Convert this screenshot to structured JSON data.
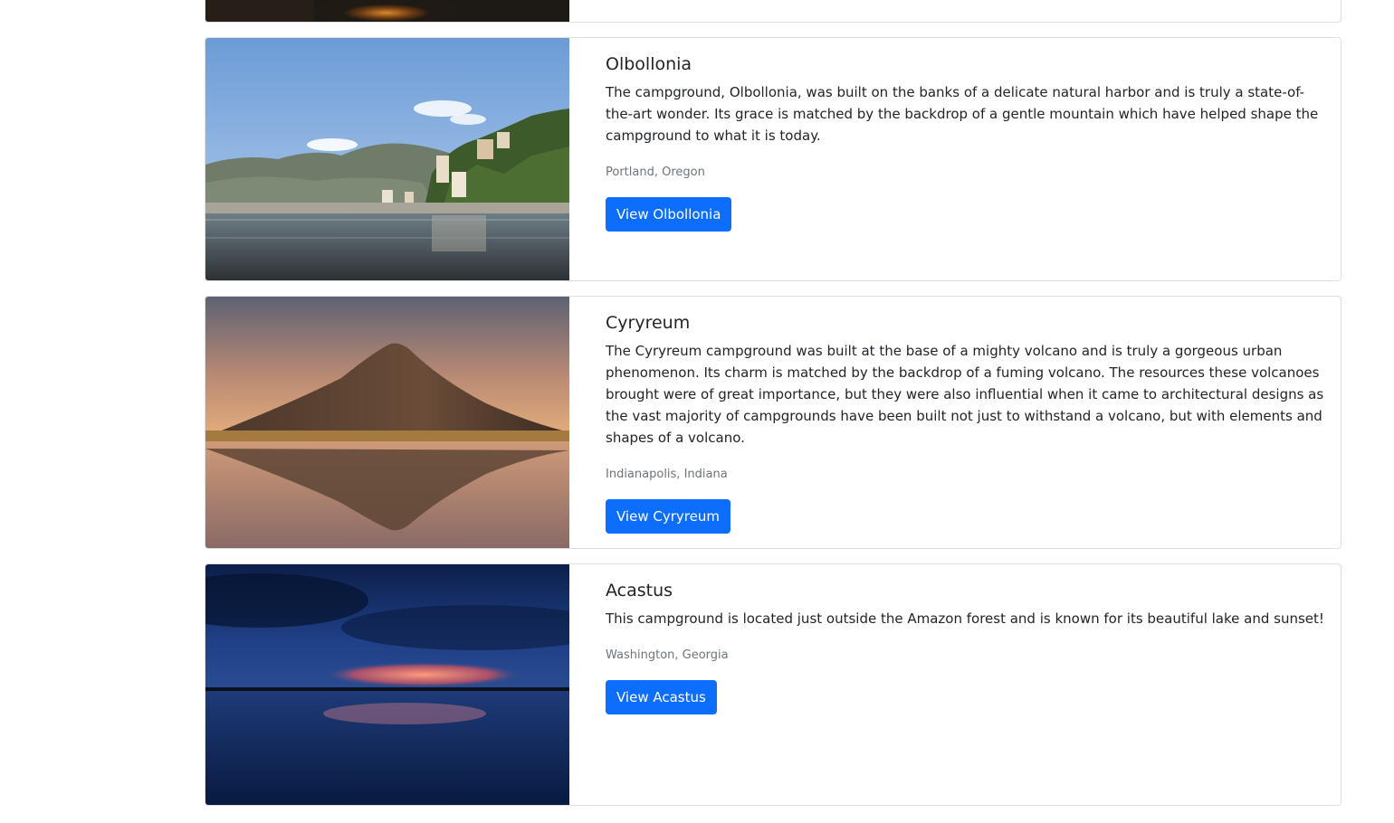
{
  "campgrounds": [
    {
      "title": "Olbollonia",
      "description": "The campground, Olbollonia, was built on the banks of a delicate natural harbor and is truly a state-of-the-art wonder. Its grace is matched by the backdrop of a gentle mountain which have helped shape the campground to what it is today.",
      "location": "Portland, Oregon",
      "button_label": "View Olbollonia",
      "image": "coastal-village-harbor-photo"
    },
    {
      "title": "Cyryreum",
      "description": "The Cyryreum campground was built at the base of a mighty volcano and is truly a gorgeous urban phenomenon. Its charm is matched by the backdrop of a fuming volcano. The resources these volcanoes brought were of great importance, but they were also influential when it came to architectural designs as the vast majority of campgrounds have been built not just to withstand a volcano, but with elements and shapes of a volcano.",
      "location": "Indianapolis, Indiana",
      "button_label": "View Cyryreum",
      "image": "volcano-reflection-photo"
    },
    {
      "title": "Acastus",
      "description": "This campground is located just outside the Amazon forest and is known for its beautiful lake and sunset!",
      "location": "Washington, Georgia",
      "button_label": "View Acastus",
      "image": "lake-sunset-photo"
    }
  ],
  "colors": {
    "primary_button": "#0d6efd",
    "muted_text": "#6c757d",
    "card_border": "#dfdfdf"
  }
}
